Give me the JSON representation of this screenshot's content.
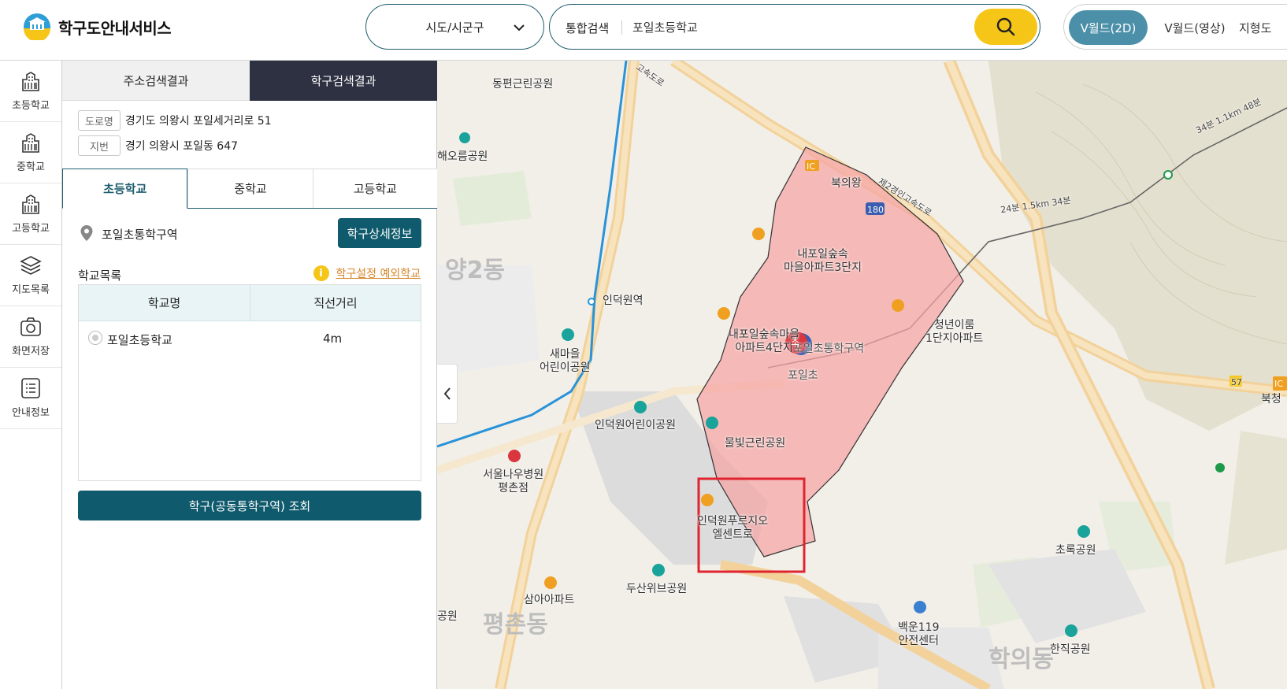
{
  "header": {
    "app_title": "학구도안내서비스",
    "region_select": "시도/시군구",
    "search_label": "통합검색",
    "search_value": "포일초등학교",
    "view_2d": "V월드(2D)",
    "view_video": "V월드(영상)",
    "view_terrain": "지형도"
  },
  "rail": [
    {
      "label": "초등학교",
      "icon": "building-icon"
    },
    {
      "label": "중학교",
      "icon": "building-icon"
    },
    {
      "label": "고등학교",
      "icon": "building-icon"
    },
    {
      "label": "지도목록",
      "icon": "layers-icon"
    },
    {
      "label": "화면저장",
      "icon": "camera-icon"
    },
    {
      "label": "안내정보",
      "icon": "document-list-icon"
    }
  ],
  "panel": {
    "tab_address": "주소검색결과",
    "tab_district": "학구검색결과",
    "road_badge": "도로명",
    "road_address": "경기도 의왕시 포일세거리로 51",
    "lot_badge": "지번",
    "lot_address": "경기 의왕시 포일동 647",
    "level_tabs": [
      "초등학교",
      "중학교",
      "고등학교"
    ],
    "district_name": "포일초통학구역",
    "detail_button": "학구상세정보",
    "list_title": "학교목록",
    "except_link": "학구설정 예외학교",
    "info_glyph": "i",
    "table": {
      "headers": [
        "학교명",
        "직선거리"
      ],
      "rows": [
        {
          "name": "포일초등학교",
          "distance": "4m"
        }
      ]
    },
    "query_button": "학구(공동통학구역) 조회"
  },
  "map": {
    "labels": {
      "dongpyeon": "동편근린공원",
      "haeoreum": "해오름공원",
      "yang2": "양2동",
      "indeokwon_st": "인덕원역",
      "saemaeul": "새마을\n어린이공원",
      "won": "원",
      "indeokwon_park": "인덕원어린이공원",
      "seoul_hosp": "서울나우병원\n평촌점",
      "samah": "삼아아파트",
      "dusan": "두산위브공원",
      "park_left": "공원",
      "pyeongchon": "평촌동",
      "bukuiwang": "북의왕",
      "line2": "제2경인고속도로",
      "apt3": "내포일숲속\n마을아파트3단지",
      "apt4": "내포일숲속마을\n아파트4단지",
      "district_on_map": "포일초통학구역",
      "school_on_map": "포일초",
      "mulbit": "물빛근린공원",
      "cheongnyeon": "청년이룸\n1단지아파트",
      "prugio": "인덕원푸르지오\n엘센트로",
      "chorok": "초록공원",
      "baekun": "백운119\n안전센터",
      "hanjik": "한직공원",
      "bukcheong": "북청",
      "hwagye": "학의동",
      "route_a": "24분 1.5km 34분",
      "route_b": "34분 1.1km 48분",
      "road_57": "57",
      "ic": "IC",
      "ic_right": "IC",
      "road_180": "180",
      "school_marker": "초",
      "expressway_left": "고속도로"
    }
  },
  "colors": {
    "primary": "#0f5a6c",
    "active_tab": "#2e3142",
    "accent_yellow": "#f5c518",
    "district_fill": "#f5a3a3",
    "highlight_box": "#e0242f"
  }
}
